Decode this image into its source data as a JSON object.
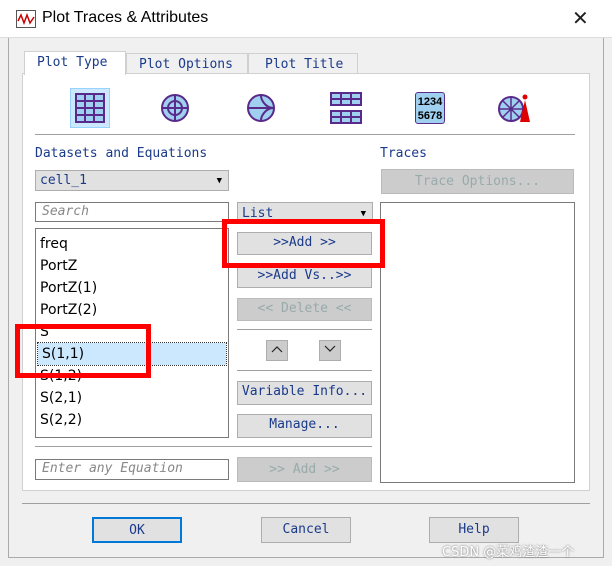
{
  "window": {
    "title": "Plot Traces & Attributes",
    "close": "✕"
  },
  "tabs": [
    {
      "label": "Plot Type"
    },
    {
      "label": "Plot Options"
    },
    {
      "label": "Plot Title"
    }
  ],
  "plot_types": [
    "rectangular-plot-icon",
    "polar-plot-icon",
    "smith-chart-icon",
    "stacked-rectangular-icon",
    "data-list-icon",
    "antenna-plot-icon"
  ],
  "data_list_icon_text": [
    "1234",
    "5678"
  ],
  "datasets": {
    "label": "Datasets and Equations",
    "selected_dataset": "cell_1",
    "search_placeholder": "Search",
    "view_mode": "List",
    "items": [
      "freq",
      "PortZ",
      "PortZ(1)",
      "PortZ(2)",
      "S",
      "S(1,1)",
      "S(1,2)",
      "S(2,1)",
      "S(2,2)"
    ],
    "selected_item": "S(1,1)",
    "equation_placeholder": "Enter any Equation"
  },
  "buttons": {
    "add": ">>Add >>",
    "add_vs": ">>Add Vs..>>",
    "delete": "<< Delete <<",
    "up": "^",
    "down": "v",
    "variable_info": "Variable Info...",
    "manage": "Manage...",
    "equation_add": ">> Add >>"
  },
  "traces": {
    "label": "Traces",
    "trace_options": "Trace Options..."
  },
  "dialog": {
    "ok": "OK",
    "cancel": "Cancel",
    "help": "Help"
  },
  "watermark": "CSDN @菜鸡渣渣一个",
  "colors": {
    "highlight": "#ff0000",
    "selection": "#cce8ff",
    "text": "#1a3a8a"
  }
}
